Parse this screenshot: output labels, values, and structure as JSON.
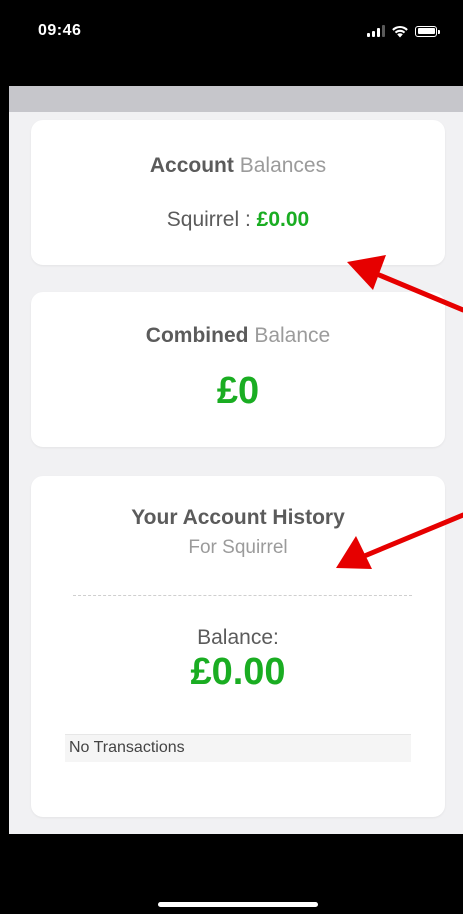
{
  "status_bar": {
    "time": "09:46"
  },
  "account_balances": {
    "title_bold": "Account",
    "title_light": "Balances",
    "account_name": "Squirrel",
    "separator": " : ",
    "amount": "£0.00"
  },
  "combined_balance": {
    "title_bold": "Combined",
    "title_light": "Balance",
    "amount": "£0"
  },
  "account_history": {
    "title": "Your Account History",
    "subtitle": "For Squirrel",
    "balance_label": "Balance:",
    "balance_amount": "£0.00",
    "transactions_text": "No Transactions"
  },
  "colors": {
    "accent_green": "#1aad22",
    "annotation_red": "#e60000",
    "strip_gray": "#c6c6cb"
  }
}
